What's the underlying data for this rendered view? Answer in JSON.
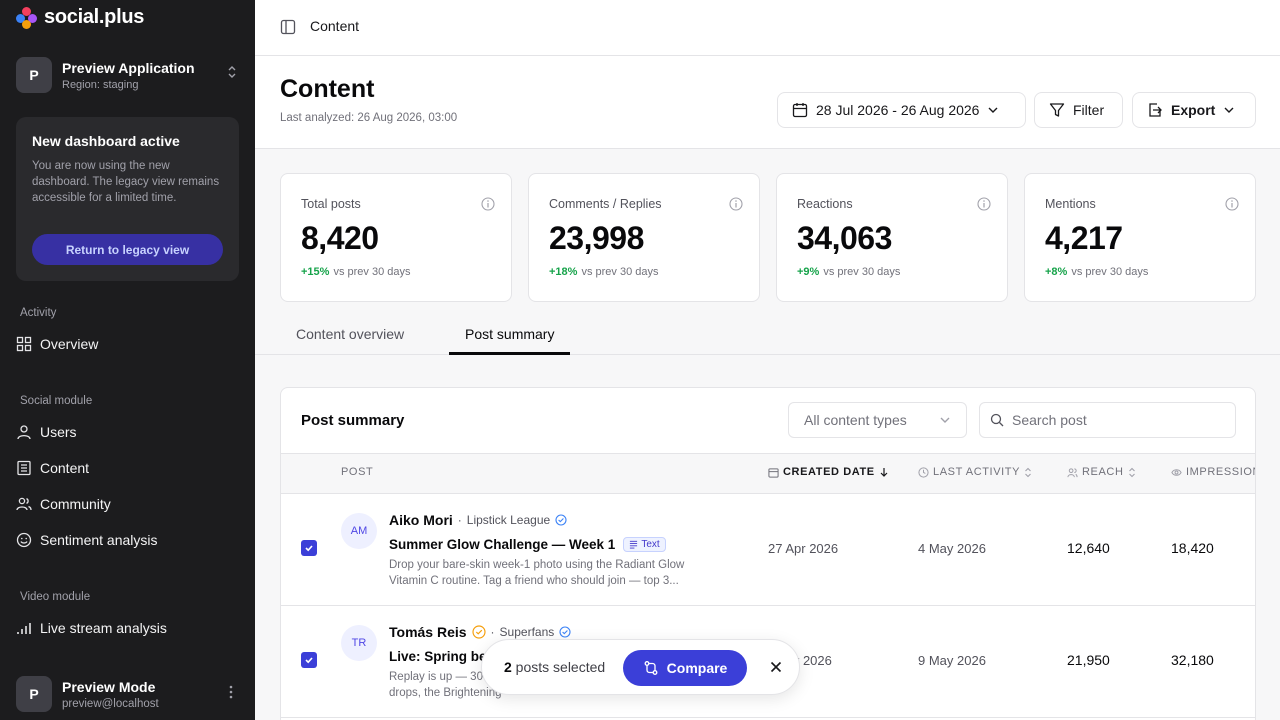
{
  "brand": {
    "name": "social.plus",
    "accent": "#3b3fd8"
  },
  "app": {
    "initial": "P",
    "name": "Preview Application",
    "region": "Region: staging"
  },
  "notice": {
    "title": "New dashboard active",
    "text": "You are now using the new dashboard. The legacy view remains accessible for a limited time.",
    "button": "Return to legacy view"
  },
  "nav": {
    "activity_label": "Activity",
    "overview": "Overview",
    "social_label": "Social module",
    "users": "Users",
    "content": "Content",
    "community": "Community",
    "sentiment": "Sentiment analysis",
    "video_label": "Video module",
    "livestream": "Live stream analysis"
  },
  "user": {
    "initial": "P",
    "name": "Preview Mode",
    "email": "preview@localhost"
  },
  "breadcrumb": "Content",
  "page": {
    "title": "Content",
    "analyzed": "Last analyzed: 26 Aug 2026, 03:00",
    "date_range": "28 Jul 2026 - 26 Aug 2026",
    "filter": "Filter",
    "export": "Export"
  },
  "stats": [
    {
      "label": "Total posts",
      "value": "8,420",
      "delta": "+15%",
      "compare": "vs prev 30 days"
    },
    {
      "label": "Comments / Replies",
      "value": "23,998",
      "delta": "+18%",
      "compare": "vs prev 30 days"
    },
    {
      "label": "Reactions",
      "value": "34,063",
      "delta": "+9%",
      "compare": "vs prev 30 days"
    },
    {
      "label": "Mentions",
      "value": "4,217",
      "delta": "+8%",
      "compare": "vs prev 30 days"
    }
  ],
  "tabs": [
    {
      "label": "Content overview"
    },
    {
      "label": "Post summary",
      "active": true
    }
  ],
  "summary": {
    "title": "Post summary",
    "type_select": "All content types",
    "search_placeholder": "Search post",
    "columns": {
      "post": "POST",
      "created": "CREATED DATE",
      "last_activity": "LAST ACTIVITY",
      "reach": "REACH",
      "impressions": "IMPRESSIONS"
    },
    "rows": [
      {
        "initials": "AM",
        "author": "Aiko Mori",
        "community": "Lipstick League",
        "title": "Summer Glow Challenge — Week 1",
        "type": "Text",
        "body": "Drop your bare-skin week-1 photo using the Radiant Glow Vitamin C routine. Tag a friend who should join — top 3...",
        "created": "27 Apr 2026",
        "last_activity": "4 May 2026",
        "reach": "12,640",
        "impressions": "18,420",
        "selected": true
      },
      {
        "initials": "TR",
        "author": "Tomás Reis",
        "community": "Superfans",
        "title": "Live: Spring bea",
        "type": "",
        "body_line1": "Replay is up — 30",
        "body_line2": "drops, the Brightening",
        "created": "r 2026",
        "last_activity": "9 May 2026",
        "reach": "21,950",
        "impressions": "32,180",
        "selected": true
      }
    ]
  },
  "selection_bar": {
    "count": "2",
    "label": " posts selected",
    "compare": "Compare"
  }
}
